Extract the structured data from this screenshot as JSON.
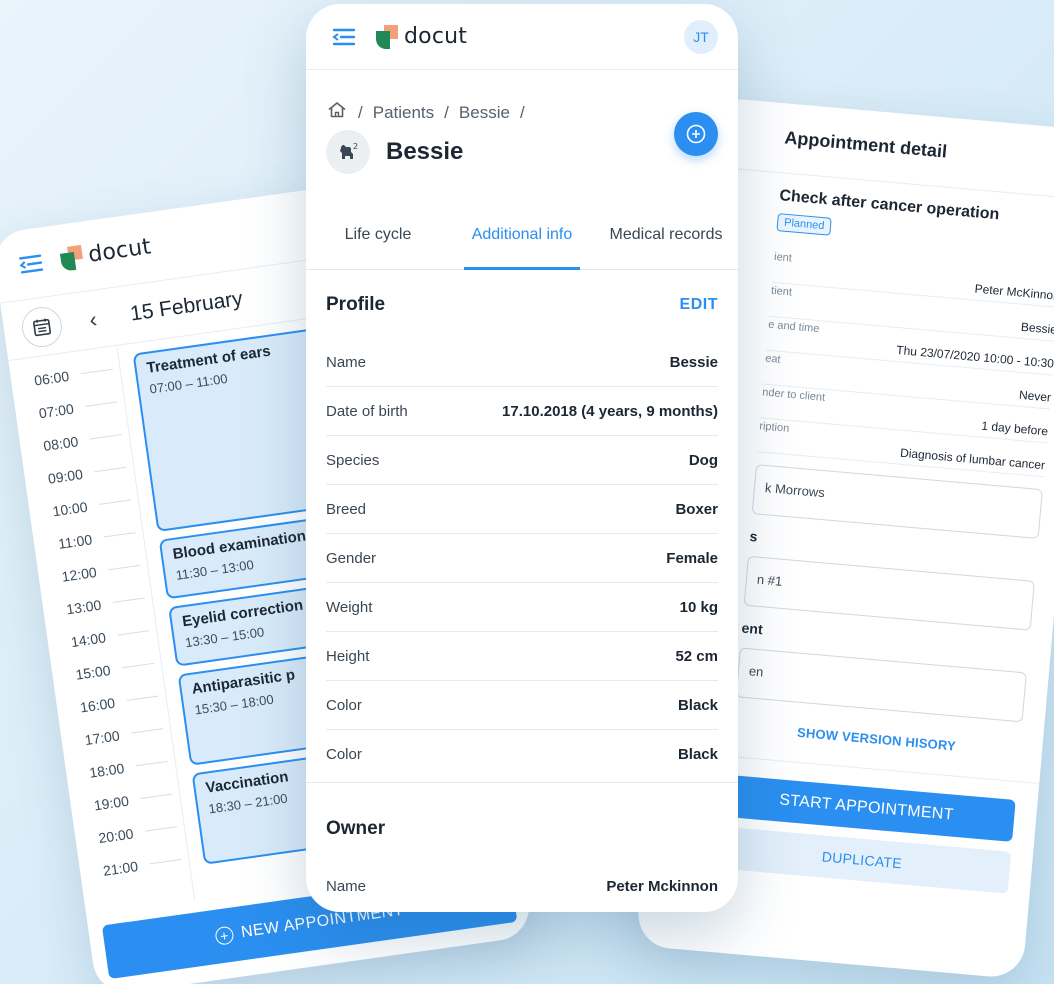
{
  "brand": {
    "logo_text": "docut"
  },
  "calendar": {
    "date_title": "15 February",
    "times": [
      "06:00",
      "07:00",
      "08:00",
      "09:00",
      "10:00",
      "11:00",
      "12:00",
      "13:00",
      "14:00",
      "15:00",
      "16:00",
      "17:00",
      "18:00",
      "19:00",
      "20:00",
      "21:00"
    ],
    "events": [
      {
        "title": "Treatment of ears",
        "time": "07:00 – 11:00"
      },
      {
        "title": "Blood examination",
        "time": "11:30 – 13:00"
      },
      {
        "title": "Eyelid correction",
        "time": "13:30 – 15:00"
      },
      {
        "title": "Antiparasitic p",
        "time": "15:30 – 18:00"
      },
      {
        "title": "Vaccination",
        "time": "18:30 – 21:00"
      }
    ],
    "new_appointment_label": "NEW APPOINTMENT"
  },
  "patient": {
    "user_initials": "JT",
    "breadcrumb": [
      "Patients",
      "Bessie"
    ],
    "name": "Bessie",
    "tabs": [
      "Life cycle",
      "Additional info",
      "Medical records"
    ],
    "active_tab": "Additional info",
    "profile": {
      "title": "Profile",
      "edit_label": "EDIT",
      "rows": [
        {
          "key": "Name",
          "value": "Bessie"
        },
        {
          "key": "Date of birth",
          "value": "17.10.2018 (4 years, 9 months)"
        },
        {
          "key": "Species",
          "value": "Dog"
        },
        {
          "key": "Breed",
          "value": "Boxer"
        },
        {
          "key": "Gender",
          "value": "Female"
        },
        {
          "key": "Weight",
          "value": "10 kg"
        },
        {
          "key": "Height",
          "value": "52 cm"
        },
        {
          "key": "Color",
          "value": "Black"
        },
        {
          "key": "Color",
          "value": "Black"
        }
      ]
    },
    "owner": {
      "title": "Owner",
      "rows": [
        {
          "key": "Name",
          "value": "Peter Mckinnon"
        }
      ]
    }
  },
  "appointment": {
    "title": "Appointment detail",
    "subtitle": "Check after cancer operation",
    "status": "Planned",
    "rows": [
      {
        "label": "ient",
        "value": "Peter McKinnon"
      },
      {
        "label": "tient",
        "value": "Bessie"
      },
      {
        "label": "e and time",
        "value": "Thu 23/07/2020 10:00 - 10:30"
      },
      {
        "label": "eat",
        "value": "Never"
      },
      {
        "label": "nder to client",
        "value": "1 day before"
      },
      {
        "label": "ription",
        "value": "Diagnosis of lumbar cancer"
      }
    ],
    "field_1": "k Morrows",
    "label_1": "s",
    "field_2": "n #1",
    "label_2": "ent",
    "field_3": "en",
    "show_history_label": "SHOW VERSION HISORY",
    "start_label": "START APPOINTMENT",
    "duplicate_label": "DUPLICATE"
  },
  "colors": {
    "accent": "#2a8ff0",
    "logo_green": "#1f8a55",
    "logo_orange": "#f2a07a",
    "background": "#d7ebf7"
  },
  "icons": [
    "menu-icon",
    "calendar-icon",
    "chevron-left-icon",
    "home-icon",
    "pet-icon",
    "add-circle-icon",
    "close-icon"
  ]
}
